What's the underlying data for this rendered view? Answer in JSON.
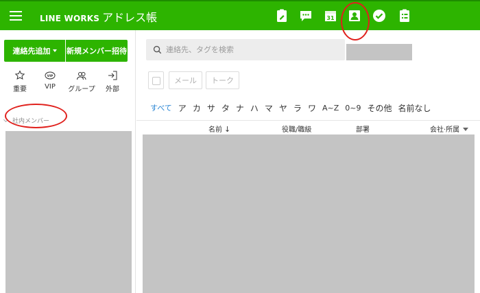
{
  "header": {
    "brand": "LINE WORKS",
    "app_name": "アドレス帳",
    "apps": [
      {
        "name": "board-app-icon"
      },
      {
        "name": "talk-app-icon"
      },
      {
        "name": "calendar-app-icon",
        "text": "31"
      },
      {
        "name": "contacts-app-icon"
      },
      {
        "name": "task-app-icon"
      },
      {
        "name": "form-app-icon"
      }
    ]
  },
  "sidebar": {
    "add_contact": "連絡先追加",
    "invite_member": "新規メンバー招待",
    "quick_links": [
      {
        "label": "重要",
        "icon": "star-icon"
      },
      {
        "label": "VIP",
        "icon": "vip-icon",
        "badge": "VIP"
      },
      {
        "label": "グループ",
        "icon": "group-icon"
      },
      {
        "label": "外部",
        "icon": "external-icon"
      }
    ],
    "section": "社内メンバー"
  },
  "main": {
    "search_placeholder": "連絡先、タグを検索",
    "actions": {
      "mail": "メール",
      "talk": "トーク"
    },
    "filters": [
      "すべて",
      "ア",
      "カ",
      "サ",
      "タ",
      "ナ",
      "ハ",
      "マ",
      "ヤ",
      "ラ",
      "ワ",
      "A~Z",
      "0~9",
      "その他",
      "名前なし"
    ],
    "columns": {
      "name": "名前",
      "sort_arrow": "↓",
      "title": "役職/職級",
      "department": "部署",
      "company": "会社·所属"
    }
  },
  "colors": {
    "brand_green": "#2db400",
    "annotation_red": "#e0201c",
    "active_filter": "#2a86d4",
    "redaction_gray": "#c4c4c4"
  }
}
